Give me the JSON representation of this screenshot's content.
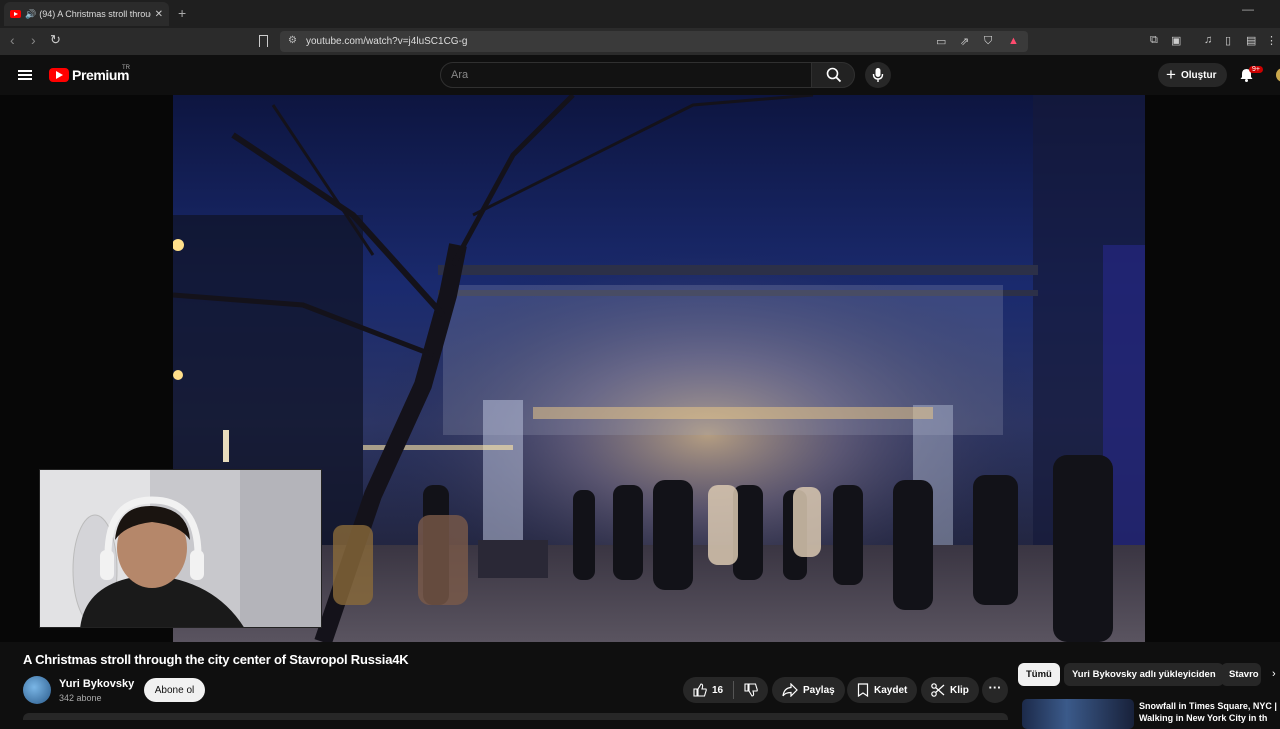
{
  "browser": {
    "tab_title": "(94) A Christmas stroll throug",
    "url": "youtube.com/watch?v=j4luSC1CG-g"
  },
  "youtube": {
    "brand": "Premium",
    "brand_region": "TR",
    "search_placeholder": "Ara",
    "create_label": "Oluştur",
    "notification_count": "9+"
  },
  "video": {
    "title": "A Christmas stroll through the city center of Stavropol Russia4K",
    "channel_name": "Yuri Bykovsky",
    "subscribers": "342 abone",
    "subscribe_label": "Abone ol",
    "like_count": "16",
    "share_label": "Paylaş",
    "save_label": "Kaydet",
    "clip_label": "Klip"
  },
  "related": {
    "chips": [
      "Tümü",
      "Yuri Bykovsky adlı yükleyiciden",
      "Stavro"
    ],
    "first_title_line1": "Snowfall in Times Square, NYC |",
    "first_title_line2": "Walking in New York City in th"
  },
  "colors": {
    "yt_red": "#ff0000",
    "background": "#0f0f0f",
    "pill": "#272727"
  }
}
